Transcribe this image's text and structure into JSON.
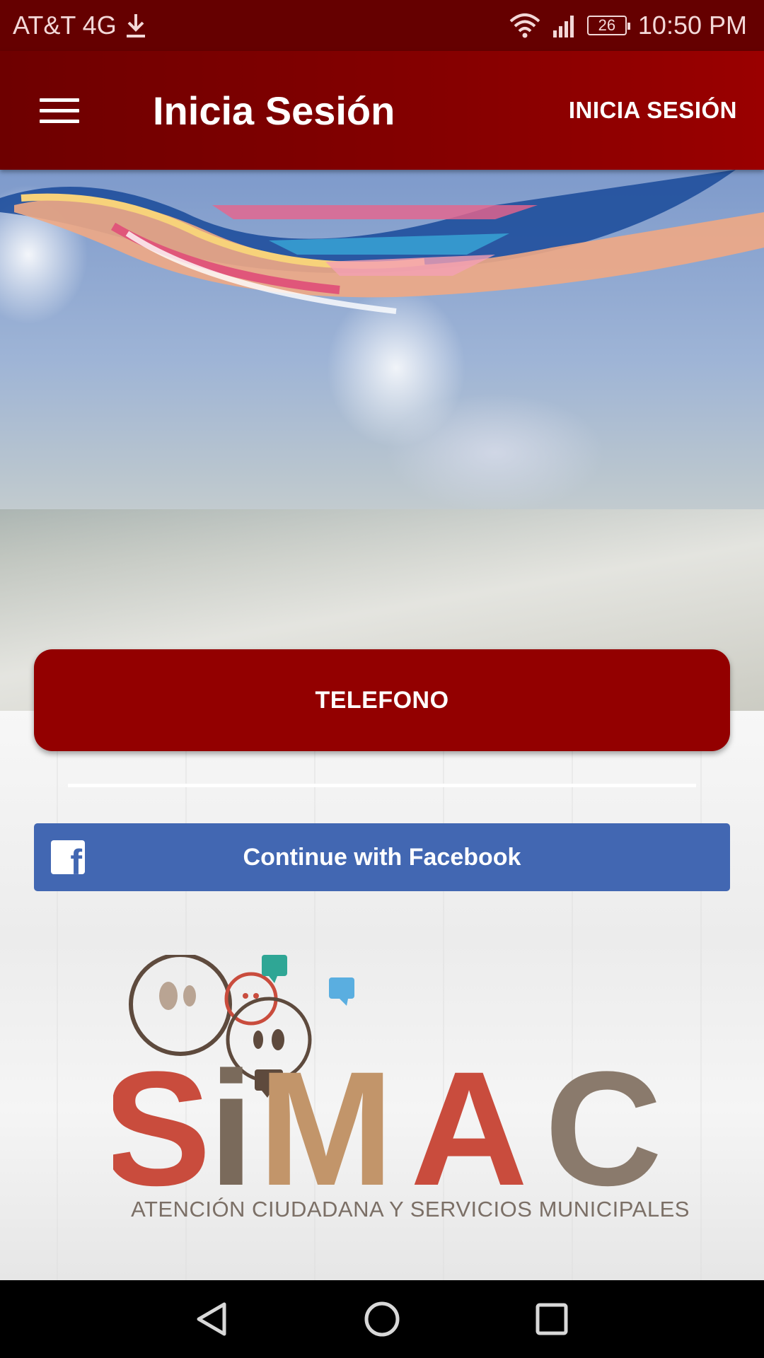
{
  "status_bar": {
    "carrier": "AT&T 4G",
    "battery": "26",
    "time": "10:50 PM",
    "icons": [
      "download-icon",
      "wifi-icon",
      "signal-icon",
      "battery-icon"
    ]
  },
  "app_bar": {
    "title": "Inicia Sesión",
    "action": "INICIA SESIÓN",
    "color": "#860000"
  },
  "buttons": {
    "telefono": "TELEFONO",
    "facebook": "Continue with Facebook",
    "telefono_color": "#930000",
    "facebook_color": "#4267b2"
  },
  "logo": {
    "letters": [
      "S",
      "i",
      "M",
      "A",
      "C"
    ],
    "subtitle": "ATENCIÓN CIUDADANA Y SERVICIOS MUNICIPALES",
    "colors": [
      "#c94c3d",
      "#7a6a5b",
      "#c2956a",
      "#c94c3d",
      "#8a7a6c"
    ]
  },
  "nav_bar": {
    "icons": [
      "back-icon",
      "home-icon",
      "recents-icon"
    ]
  }
}
